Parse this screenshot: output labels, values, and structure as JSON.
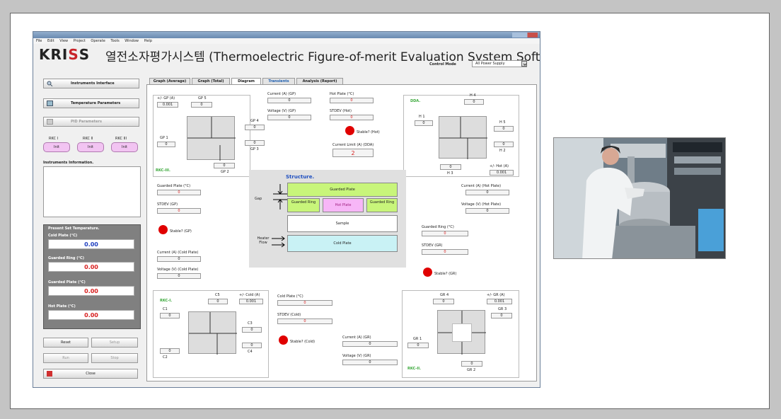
{
  "window": {
    "title": "KRISS Thermoelectric Figure-of-merit Evaluation System Software"
  },
  "menu": [
    "File",
    "Edit",
    "View",
    "Project",
    "Operate",
    "Tools",
    "Window",
    "Help"
  ],
  "header": {
    "logo_prefix": "KRI",
    "logo_accent": "S",
    "logo_suffix": "S",
    "title": "열전소자평가시스템 (Thermoelectric Figure-of-merit Evaluation System Software.)"
  },
  "control_mode": {
    "label": "Control Mode",
    "value": "All Power Supply"
  },
  "left": {
    "btn_instruments": "Instruments Interface",
    "btn_temp": "Temperature Parameters",
    "btn_pid": "PID Parameters",
    "rkc_labels": [
      "RKC I",
      "RKC II",
      "RKC III"
    ],
    "rkc_buttons": [
      "Init",
      "Init",
      "Init"
    ],
    "info_label": "Instruments Information.",
    "set_temp_title": "Present Set Temperature.",
    "cold_plate_label": "Cold Plate (°C)",
    "cold_plate_value": "0.00",
    "guarded_ring_label": "Guarded Ring (°C)",
    "guarded_ring_value": "0.00",
    "guarded_plate_label": "Guarded Plate (°C)",
    "guarded_plate_value": "0.00",
    "hot_plate_label": "Hot Plate (°C)",
    "hot_plate_value": "0.00",
    "reset": "Reset",
    "setup": "Setup",
    "run": "Run",
    "stop": "Stop",
    "close": "Close"
  },
  "tabs": [
    "Graph (Average)",
    "Graph (Total)",
    "Diagram",
    "Transients",
    "Analysis (Report)"
  ],
  "diagram": {
    "rkc3": {
      "name": "RKC-III.",
      "gp_label": "+/- GP (A)",
      "gp_value": "0.001",
      "gp1": "GP 1",
      "gp1_v": "0",
      "gp2": "GP 2",
      "gp2_v": "0",
      "gp3": "GP 3",
      "gp3_v": "0",
      "gp4": "GP 4",
      "gp4_v": "0",
      "gp5": "GP 5",
      "gp5_v": "0"
    },
    "gp_current_label": "Current (A) (GP)",
    "gp_current": "0",
    "gp_voltage_label": "Voltage (V) (GP)",
    "gp_voltage": "0",
    "hot_plate_label": "Hot Plate (°C)",
    "hot_plate": "0",
    "stdev_hot_label": "STDEV (Hot)",
    "stdev_hot": "0",
    "stable_hot": "Stable? (Hot)",
    "current_limit_label": "Current Limit (A) (DDA)",
    "current_limit": "2",
    "dda": {
      "name": "DDA.",
      "h1": "H 1",
      "h1_v": "0",
      "h2": "H 2",
      "h2_v": "0",
      "h3": "H 3",
      "h3_v": "0",
      "h4": "H 4",
      "h4_v": "0",
      "h5": "H 5",
      "h5_v": "0",
      "hot_label": "+/- Hot (A)",
      "hot_value": "0.001"
    },
    "gp_temp_label": "Guarded Plate (°C)",
    "gp_temp": "0",
    "stdev_gp_label": "STDEV (GP)",
    "stdev_gp": "0",
    "stable_gp": "Stable? (GP)",
    "cold_current_label": "Current (A) (Cold Plate)",
    "cold_current": "0",
    "cold_voltage_label": "Voltage (V) (Cold Plate)",
    "cold_voltage": "0",
    "structure": {
      "title": "Structure.",
      "guarded_plate": "Guarded Plate",
      "gap": "Gap",
      "guarded_ring_l": "Guarded Ring",
      "hot_plate": "Hot Plate",
      "guarded_ring_r": "Guarded Ring",
      "sample": "Sample",
      "heater_flow": "Heater Flow",
      "cold_plate": "Cold Plate"
    },
    "hot_current_label": "Current (A) (Hot Plate)",
    "hot_current": "0",
    "hot_voltage_label": "Voltage (V) (Hot Plate)",
    "hot_voltage": "0",
    "gr_temp_label": "Guarded Ring (°C)",
    "gr_temp": "0",
    "stdev_gr_label": "STDEV (GR)",
    "stdev_gr": "0",
    "stable_gr": "Stable? (GR)",
    "rkc1": {
      "name": "RKC-I.",
      "c1": "C1",
      "c1_v": "0",
      "c2": "C2",
      "c2_v": "0",
      "c3": "C3",
      "c3_v": "0",
      "c4": "C4",
      "c4_v": "0",
      "c5": "C5",
      "c5_v": "0",
      "cold_label": "+/- Cold (A)",
      "cold_value": "0.001"
    },
    "cold_plate_label": "Cold Plate (°C)",
    "cold_plate": "0",
    "stdev_cold_label": "STDEV (Cold)",
    "stdev_cold": "0",
    "stable_cold": "Stable? (Cold)",
    "gr_current_label": "Current (A) (GR)",
    "gr_current": "0",
    "gr_voltage_label": "Voltage (V) (GR)",
    "gr_voltage": "0",
    "rkc2": {
      "name": "RKC-II.",
      "gr1": "GR 1",
      "gr1_v": "0",
      "gr2": "GR 2",
      "gr2_v": "0",
      "gr3": "GR 3",
      "gr3_v": "0",
      "gr4": "GR 4",
      "gr4_v": "0",
      "gr_label": "+/- GR (A)",
      "gr_value": "0.001"
    }
  },
  "colors": {
    "stable_indicator": "#e00000",
    "rkc_green": "#3aa83a",
    "guarded_plate": "#c8f57a",
    "hot_plate": "#f7b6f7",
    "cold_plate": "#c9f2f5",
    "red_value": "#d82020"
  }
}
